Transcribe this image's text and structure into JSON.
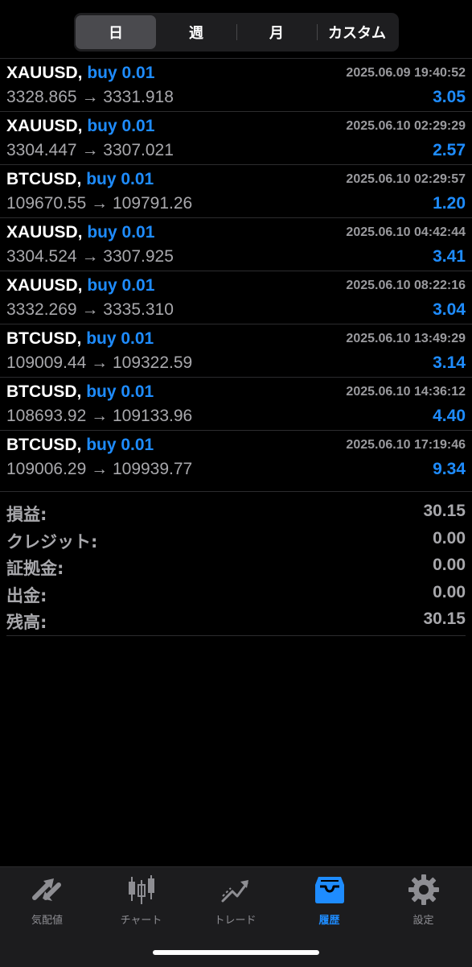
{
  "period_tabs": [
    {
      "label": "日",
      "active": true
    },
    {
      "label": "週",
      "active": false
    },
    {
      "label": "月",
      "active": false
    },
    {
      "label": "カスタム",
      "active": false
    }
  ],
  "trades": [
    {
      "symbol": "XAUUSD,",
      "side": "buy 0.01",
      "time": "2025.06.09 19:40:52",
      "open": "3328.865",
      "close": "3331.918",
      "profit": "3.05"
    },
    {
      "symbol": "XAUUSD,",
      "side": "buy 0.01",
      "time": "2025.06.10 02:29:29",
      "open": "3304.447",
      "close": "3307.021",
      "profit": "2.57"
    },
    {
      "symbol": "BTCUSD,",
      "side": "buy 0.01",
      "time": "2025.06.10 02:29:57",
      "open": "109670.55",
      "close": "109791.26",
      "profit": "1.20"
    },
    {
      "symbol": "XAUUSD,",
      "side": "buy 0.01",
      "time": "2025.06.10 04:42:44",
      "open": "3304.524",
      "close": "3307.925",
      "profit": "3.41"
    },
    {
      "symbol": "XAUUSD,",
      "side": "buy 0.01",
      "time": "2025.06.10 08:22:16",
      "open": "3332.269",
      "close": "3335.310",
      "profit": "3.04"
    },
    {
      "symbol": "BTCUSD,",
      "side": "buy 0.01",
      "time": "2025.06.10 13:49:29",
      "open": "109009.44",
      "close": "109322.59",
      "profit": "3.14"
    },
    {
      "symbol": "BTCUSD,",
      "side": "buy 0.01",
      "time": "2025.06.10 14:36:12",
      "open": "108693.92",
      "close": "109133.96",
      "profit": "4.40"
    },
    {
      "symbol": "BTCUSD,",
      "side": "buy 0.01",
      "time": "2025.06.10 17:19:46",
      "open": "109006.29",
      "close": "109939.77",
      "profit": "9.34"
    }
  ],
  "arrow": "→",
  "summary": [
    {
      "label": "損益:",
      "value": "30.15"
    },
    {
      "label": "クレジット:",
      "value": "0.00"
    },
    {
      "label": "証拠金:",
      "value": "0.00"
    },
    {
      "label": "出金:",
      "value": "0.00"
    },
    {
      "label": "残高:",
      "value": "30.15"
    }
  ],
  "tabbar": {
    "items": [
      {
        "label": "気配値",
        "icon": "quotes-arrows-icon",
        "active": false
      },
      {
        "label": "チャート",
        "icon": "candlestick-chart-icon",
        "active": false
      },
      {
        "label": "トレード",
        "icon": "trade-trend-icon",
        "active": false
      },
      {
        "label": "履歴",
        "icon": "history-inbox-icon",
        "active": true
      },
      {
        "label": "設定",
        "icon": "settings-gear-icon",
        "active": false
      }
    ]
  },
  "colors": {
    "accent": "#1e8cff",
    "background": "#000000",
    "muted_text": "#a8a8ac",
    "inactive_icon": "#8e8e93"
  }
}
